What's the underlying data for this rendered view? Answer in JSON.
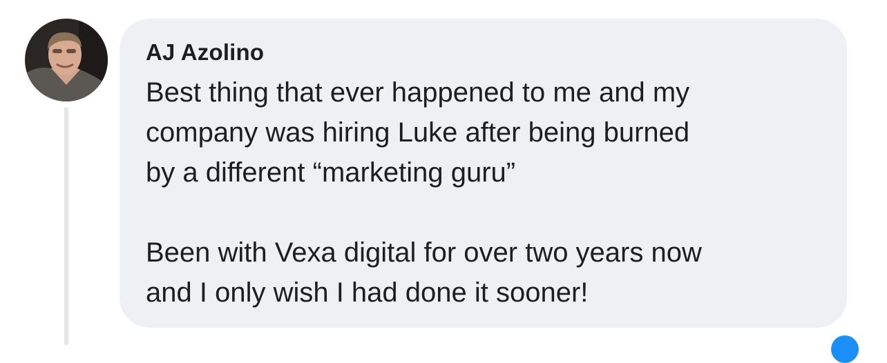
{
  "comment": {
    "author": "AJ Azolino",
    "paragraphs": [
      "Best thing that ever happened to me and my\ncompany was hiring Luke after being burned\nby a different “marketing guru”",
      "Been with Vexa digital for over two years now\nand I only wish I had done it sooner!"
    ]
  },
  "colors": {
    "bubble_background": "#eff0f4",
    "text": "#1c1e21",
    "thread_line": "#e4e6ea",
    "accent": "#1b8ef7"
  },
  "icons": {
    "avatar": "profile-photo"
  }
}
